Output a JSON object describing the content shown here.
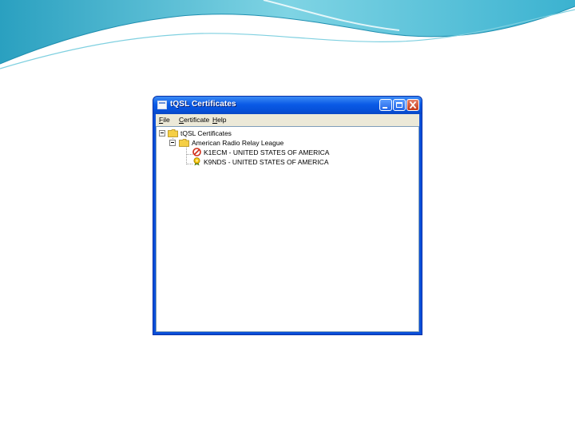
{
  "window": {
    "title": "tQSL Certificates"
  },
  "menu": {
    "file": "File",
    "certificate": "Certificate",
    "help": "Help"
  },
  "tree": {
    "root": {
      "label": "tQSL Certificates",
      "icon": "folder-icon",
      "expanded": true
    },
    "group": {
      "label": "American Radio Relay League",
      "icon": "folder-icon",
      "expanded": true
    },
    "certificates": [
      {
        "label": "K1ECM - UNITED STATES OF AMERICA",
        "icon": "no-entry-icon",
        "status_color": "#d0301c"
      },
      {
        "label": "K9NDS - UNITED STATES OF AMERICA",
        "icon": "award-ribbon-icon",
        "status_color": "#d8a800"
      }
    ]
  },
  "colors": {
    "titlebar": "#0a5ae6",
    "menubar": "#ece9d8",
    "folder": "#f5cf45",
    "slide_wave": "#5bc4d6"
  }
}
